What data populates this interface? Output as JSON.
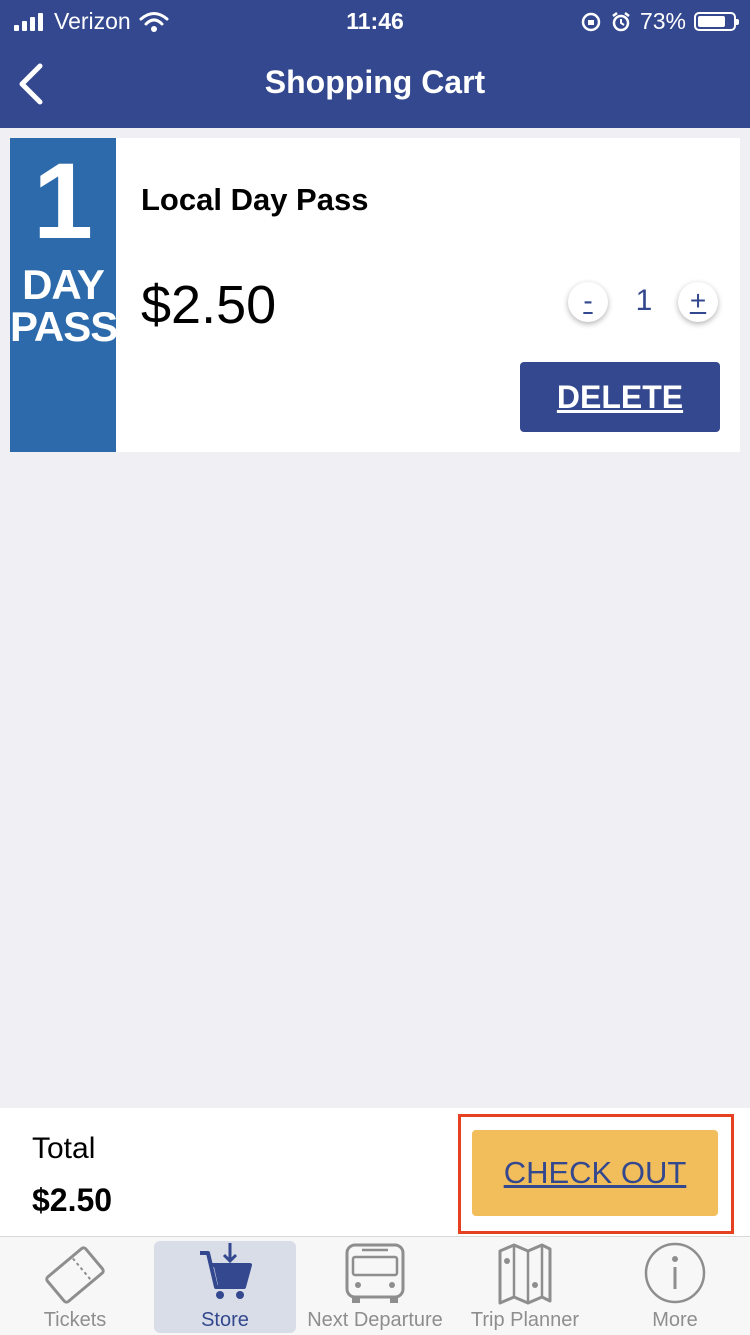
{
  "status_bar": {
    "carrier": "Verizon",
    "time": "11:46",
    "battery": "73%"
  },
  "nav": {
    "title": "Shopping Cart",
    "back_icon": "chevron-left-icon"
  },
  "cart_item": {
    "badge_number": "1",
    "badge_word1": "DAY",
    "badge_word2": "PASS",
    "name": "Local Day Pass",
    "price": "$2.50",
    "quantity": "1",
    "minus_label": "-",
    "plus_label": "+",
    "delete_label": "DELETE"
  },
  "summary": {
    "total_label": "Total",
    "total_value": "$2.50",
    "checkout_label": "CHECK OUT"
  },
  "tabs": [
    {
      "label": "Tickets",
      "icon": "ticket-icon",
      "active": false
    },
    {
      "label": "Store",
      "icon": "cart-icon",
      "active": true
    },
    {
      "label": "Next Departure",
      "icon": "bus-icon",
      "active": false
    },
    {
      "label": "Trip Planner",
      "icon": "map-icon",
      "active": false
    },
    {
      "label": "More",
      "icon": "info-icon",
      "active": false
    }
  ],
  "colors": {
    "primary": "#33488e",
    "badge": "#2c6aab",
    "checkout": "#f2bd5b",
    "highlight": "#e5401f",
    "background": "#efeff4"
  }
}
